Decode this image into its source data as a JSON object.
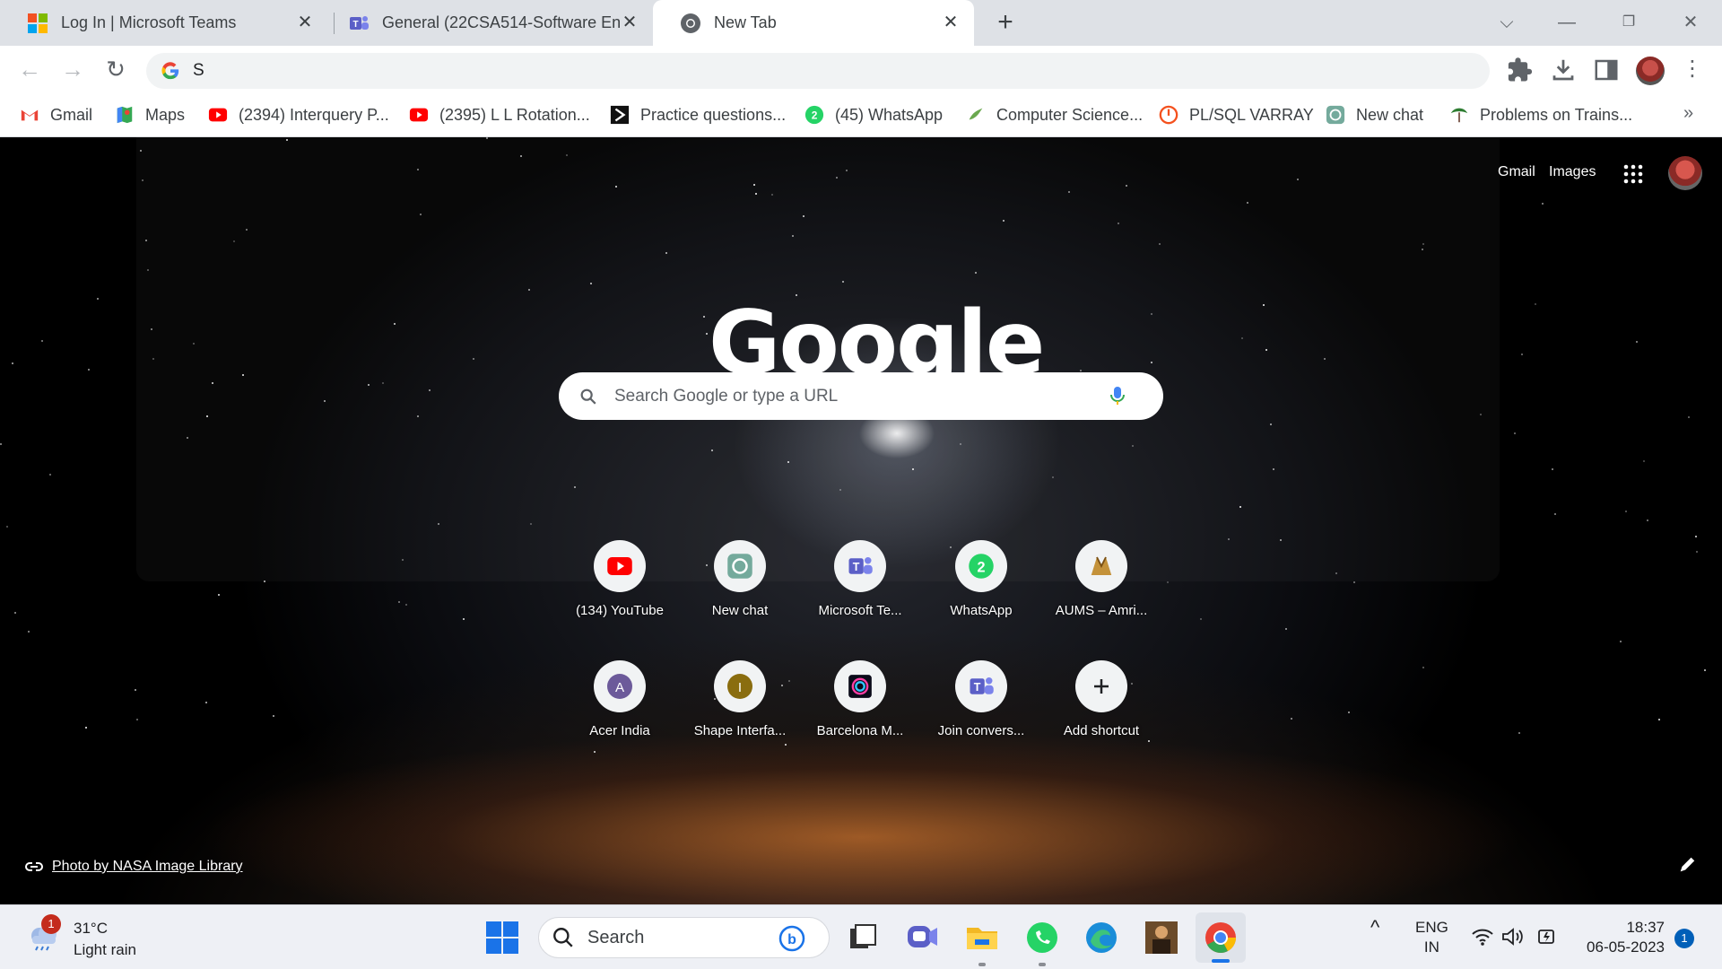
{
  "tabs": [
    {
      "title": "Log In | Microsoft Teams",
      "icon": "microsoft-logo-icon"
    },
    {
      "title": "General (22CSA514-Software Eng",
      "icon": "teams-icon"
    },
    {
      "title": "New Tab",
      "icon": "chrome-icon",
      "active": true
    }
  ],
  "omnibox": {
    "value": "S",
    "icon": "google-g-icon"
  },
  "bookmarks": [
    {
      "label": "Gmail",
      "icon": "gmail-icon"
    },
    {
      "label": "Maps",
      "icon": "maps-icon"
    },
    {
      "label": "(2394) Interquery P...",
      "icon": "youtube-icon"
    },
    {
      "label": "(2395) L L Rotation...",
      "icon": "youtube-icon"
    },
    {
      "label": "Practice questions...",
      "icon": "practice-icon"
    },
    {
      "label": "(45) WhatsApp",
      "icon": "whatsapp-icon"
    },
    {
      "label": "Computer Science...",
      "icon": "computer-science-icon"
    },
    {
      "label": "PL/SQL VARRAY",
      "icon": "plsql-icon"
    },
    {
      "label": "New chat",
      "icon": "chatgpt-icon"
    },
    {
      "label": "Problems on Trains...",
      "icon": "trains-icon"
    }
  ],
  "ntp": {
    "gmail_link": "Gmail",
    "images_link": "Images",
    "logo_text": "Google",
    "search_placeholder": "Search Google or type a URL",
    "credit": "Photo by NASA Image Library",
    "shortcuts_row1": [
      {
        "label": "(134) YouTube",
        "icon": "youtube-icon"
      },
      {
        "label": "New chat",
        "icon": "chatgpt-icon"
      },
      {
        "label": "Microsoft Te...",
        "icon": "teams-icon"
      },
      {
        "label": "WhatsApp",
        "icon": "whatsapp-icon"
      },
      {
        "label": "AUMS – Amri...",
        "icon": "aums-icon"
      }
    ],
    "shortcuts_row2": [
      {
        "label": "Acer India",
        "icon": "letter-a-icon",
        "letter": "A"
      },
      {
        "label": "Shape Interfa...",
        "icon": "letter-i-icon",
        "letter": "I"
      },
      {
        "label": "Barcelona M...",
        "icon": "barcelona-icon"
      },
      {
        "label": "Join convers...",
        "icon": "teams-icon"
      },
      {
        "label": "Add shortcut",
        "icon": "plus-icon"
      }
    ]
  },
  "taskbar": {
    "weather_temp": "31°C",
    "weather_desc": "Light rain",
    "weather_badge": "1",
    "search_label": "Search",
    "lang_top": "ENG",
    "lang_bottom": "IN",
    "time": "18:37",
    "date": "06-05-2023",
    "notif_count": "1"
  },
  "colors": {
    "accent": "#1a73e8",
    "tab_strip": "#dee1e6",
    "taskbar": "#eef0f5"
  }
}
